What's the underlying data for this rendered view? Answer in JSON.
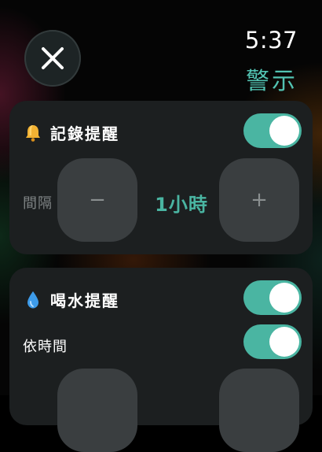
{
  "header": {
    "time": "5:37",
    "title": "警示"
  },
  "log_reminder": {
    "icon": "bell-icon",
    "label": "記錄提醒",
    "enabled": true,
    "interval_label": "間隔",
    "decrement_label": "−",
    "value": "1小時",
    "increment_label": "+"
  },
  "water_reminder": {
    "icon": "water-drop-icon",
    "label": "喝水提醒",
    "enabled": true,
    "by_time_label": "依時間",
    "by_time_enabled": true
  },
  "colors": {
    "accent": "#4ab5a2",
    "card": "#1c1f20",
    "button": "#3a3e40"
  }
}
